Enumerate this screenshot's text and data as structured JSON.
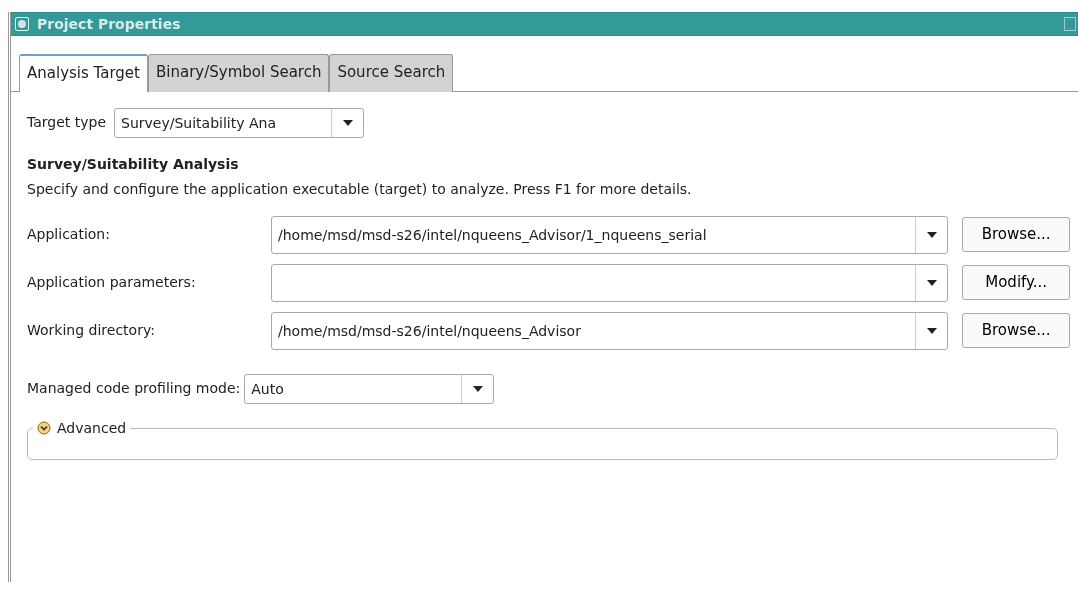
{
  "window": {
    "title": "Project Properties"
  },
  "tabs": [
    {
      "label": "Analysis Target",
      "selected": true
    },
    {
      "label": "Binary/Symbol Search",
      "selected": false
    },
    {
      "label": "Source Search",
      "selected": false
    }
  ],
  "target_type": {
    "label": "Target type",
    "value": "Survey/Suitability Ana"
  },
  "section": {
    "title": "Survey/Suitability Analysis",
    "description": "Specify and configure the application executable (target) to analyze. Press F1 for more details."
  },
  "fields": [
    {
      "label": "Application:",
      "value": "/home/msd/msd-s26/intel/nqueens_Advisor/1_nqueens_serial",
      "button": "Browse..."
    },
    {
      "label": "Application parameters:",
      "button": "Modify..."
    },
    {
      "label": "Working directory:",
      "value": "/home/msd/msd-s26/intel/nqueens_Advisor",
      "button": "Browse..."
    }
  ],
  "profiling_mode": {
    "label": "Managed code profiling mode:",
    "value": "Auto"
  },
  "advanced": {
    "label": "Advanced",
    "expanded": false
  }
}
